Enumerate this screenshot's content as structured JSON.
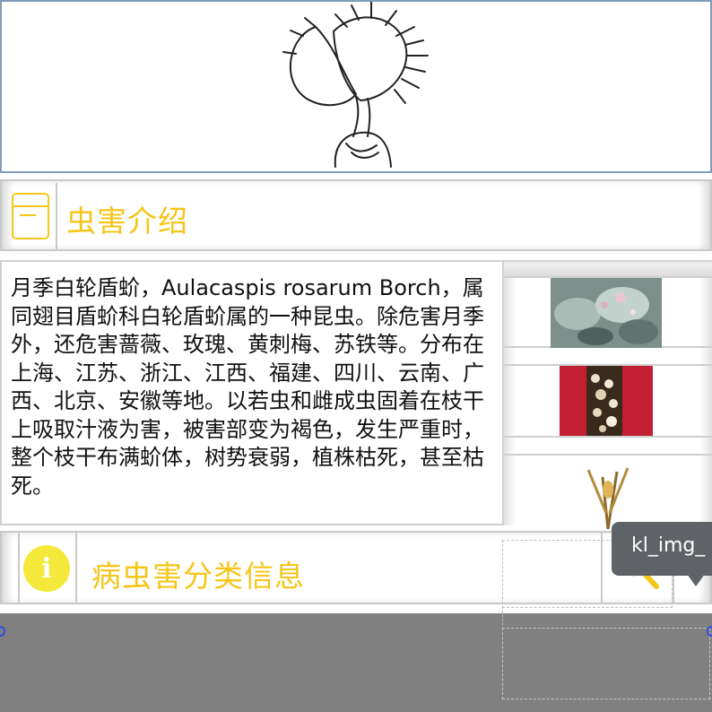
{
  "hero": {
    "image_name": "venus-flytrap-illustration"
  },
  "intro_header": {
    "icon": "note-icon",
    "title": "虫害介绍"
  },
  "description": {
    "text": "月季白轮盾蚧，Aulacaspis rosarum Borch，属同翅目盾蚧科白轮盾蚧属的一种昆虫。除危害月季外，还危害蔷薇、玫瑰、黄刺梅、苏铁等。分布在上海、江苏、浙江、江西、福建、四川、云南、广西、北京、安徽等地。以若虫和雌成虫固着在枝干上吸取汁液为害，被害部变为褐色，发生严重时，整个枝干布满蚧体，树势衰弱，植株枯死，甚至枯死。"
  },
  "thumbnails": [
    {
      "name": "pest-photo-leaves"
    },
    {
      "name": "pest-photo-branch"
    },
    {
      "name": "pest-photo-stem"
    }
  ],
  "category_header": {
    "icon": "info-icon",
    "icon_glyph": "i",
    "title": "病虫害分类信息",
    "search_icon": "search-icon"
  },
  "tooltip": {
    "text": "kl_img_"
  },
  "colors": {
    "accent_yellow": "#f5c518",
    "info_yellow": "#f4e83a",
    "bottom_bar": "#808080",
    "tooltip_bg": "#5f6368",
    "handle_blue": "#2d4de8"
  }
}
